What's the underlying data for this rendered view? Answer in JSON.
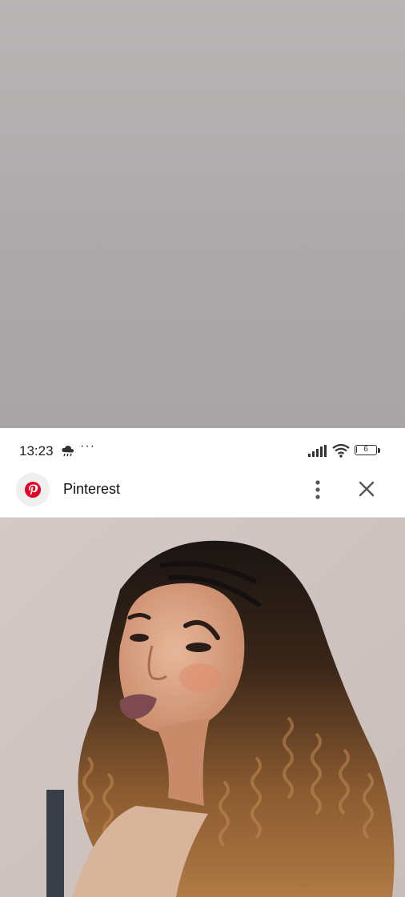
{
  "status_bar": {
    "time": "13:23",
    "more": "···",
    "battery_level": "6",
    "battery_fraction": 0.06
  },
  "header": {
    "app_name": "Pinterest",
    "brand_color": "#e60023"
  },
  "icons": {
    "weather": "cloud-rain-icon",
    "signal": "cellular-signal-icon",
    "wifi": "wifi-icon",
    "battery": "battery-icon",
    "logo": "pinterest-logo-icon",
    "kebab": "more-vertical-icon",
    "close": "close-icon"
  }
}
